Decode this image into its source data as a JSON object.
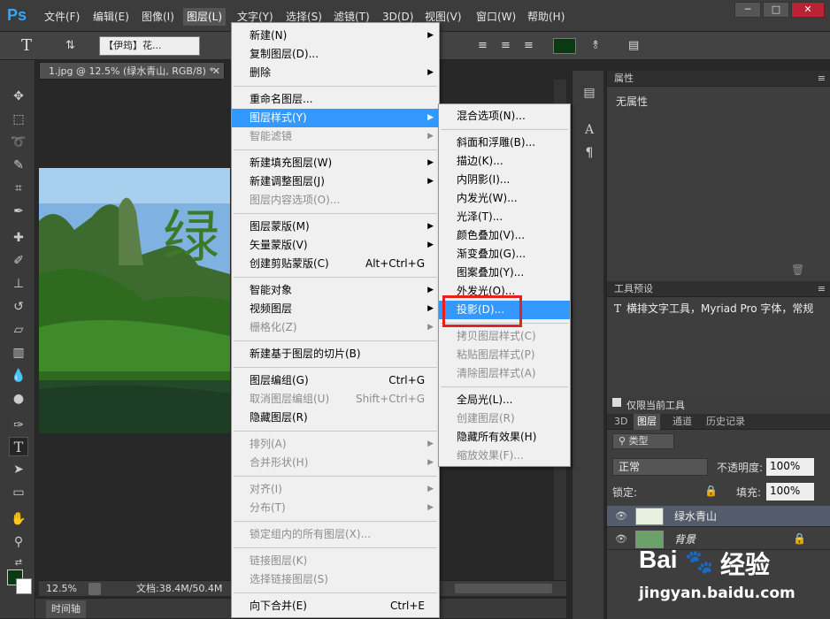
{
  "app": {
    "logo": "Ps"
  },
  "menubar": {
    "items": [
      "文件(F)",
      "编辑(E)",
      "图像(I)",
      "图层(L)",
      "文字(Y)",
      "选择(S)",
      "滤镜(T)",
      "3D(D)",
      "视图(V)",
      "窗口(W)",
      "帮助(H)"
    ],
    "window_buttons": [
      "─",
      "□",
      "✕"
    ]
  },
  "options_bar": {
    "text_tool_glyph": "T",
    "font_family": "【伊筠】花...",
    "color": "#0b3a12"
  },
  "document": {
    "tab_title": "1.jpg @ 12.5% (绿水青山, RGB/8) *",
    "canvas_text": "绿",
    "zoom": "12.5%",
    "doc_info": "文档:38.4M/50.4M"
  },
  "timeline": {
    "label": "时间轴"
  },
  "properties_panel": {
    "title": "属性",
    "content": "无属性"
  },
  "tool_presets_panel": {
    "title": "工具预设",
    "item": "横排文字工具，Myriad Pro 字体，常规",
    "checkbox_label": "仅限当前工具"
  },
  "layers_panel": {
    "tabs": [
      "3D",
      "图层",
      "通道",
      "历史记录"
    ],
    "filter_label": "类型",
    "blend_mode": "正常",
    "opacity_label": "不透明度:",
    "opacity_value": "100%",
    "lock_label": "锁定:",
    "fill_label": "填充:",
    "fill_value": "100%",
    "layers": [
      {
        "name": "绿水青山",
        "selected": true
      },
      {
        "name": "背景",
        "selected": false,
        "locked": true
      }
    ]
  },
  "layer_menu": {
    "items": [
      {
        "label": "新建(N)",
        "submenu": true
      },
      {
        "label": "复制图层(D)..."
      },
      {
        "label": "删除",
        "submenu": true
      },
      {
        "sep": true
      },
      {
        "label": "重命名图层..."
      },
      {
        "label": "图层样式(Y)",
        "submenu": true,
        "highlight": true
      },
      {
        "label": "智能滤镜",
        "submenu": true,
        "disabled": true
      },
      {
        "sep": true
      },
      {
        "label": "新建填充图层(W)",
        "submenu": true
      },
      {
        "label": "新建调整图层(J)",
        "submenu": true
      },
      {
        "label": "图层内容选项(O)...",
        "disabled": true
      },
      {
        "sep": true
      },
      {
        "label": "图层蒙版(M)",
        "submenu": true
      },
      {
        "label": "矢量蒙版(V)",
        "submenu": true
      },
      {
        "label": "创建剪贴蒙版(C)",
        "shortcut": "Alt+Ctrl+G"
      },
      {
        "sep": true
      },
      {
        "label": "智能对象",
        "submenu": true
      },
      {
        "label": "视频图层",
        "submenu": true
      },
      {
        "label": "栅格化(Z)",
        "submenu": true,
        "disabled": true
      },
      {
        "sep": true
      },
      {
        "label": "新建基于图层的切片(B)"
      },
      {
        "sep": true
      },
      {
        "label": "图层编组(G)",
        "shortcut": "Ctrl+G"
      },
      {
        "label": "取消图层编组(U)",
        "shortcut": "Shift+Ctrl+G",
        "disabled": true
      },
      {
        "label": "隐藏图层(R)"
      },
      {
        "sep": true
      },
      {
        "label": "排列(A)",
        "submenu": true,
        "disabled": true
      },
      {
        "label": "合并形状(H)",
        "submenu": true,
        "disabled": true
      },
      {
        "sep": true
      },
      {
        "label": "对齐(I)",
        "submenu": true,
        "disabled": true
      },
      {
        "label": "分布(T)",
        "submenu": true,
        "disabled": true
      },
      {
        "sep": true
      },
      {
        "label": "锁定组内的所有图层(X)...",
        "disabled": true
      },
      {
        "sep": true
      },
      {
        "label": "链接图层(K)",
        "disabled": true
      },
      {
        "label": "选择链接图层(S)",
        "disabled": true
      },
      {
        "sep": true
      },
      {
        "label": "向下合并(E)",
        "shortcut": "Ctrl+E"
      }
    ]
  },
  "layer_style_menu": {
    "items": [
      {
        "label": "混合选项(N)..."
      },
      {
        "sep": true
      },
      {
        "label": "斜面和浮雕(B)..."
      },
      {
        "label": "描边(K)..."
      },
      {
        "label": "内阴影(I)..."
      },
      {
        "label": "内发光(W)..."
      },
      {
        "label": "光泽(T)..."
      },
      {
        "label": "颜色叠加(V)..."
      },
      {
        "label": "渐变叠加(G)..."
      },
      {
        "label": "图案叠加(Y)..."
      },
      {
        "label": "外发光(O)..."
      },
      {
        "label": "投影(D)...",
        "highlight": true
      },
      {
        "sep": true
      },
      {
        "label": "拷贝图层样式(C)",
        "disabled": true
      },
      {
        "label": "粘贴图层样式(P)",
        "disabled": true
      },
      {
        "label": "清除图层样式(A)",
        "disabled": true
      },
      {
        "sep": true
      },
      {
        "label": "全局光(L)..."
      },
      {
        "label": "创建图层(R)",
        "disabled": true
      },
      {
        "label": "隐藏所有效果(H)"
      },
      {
        "label": "缩放效果(F)...",
        "disabled": true
      }
    ]
  },
  "watermark": {
    "brand": "Bai",
    "brand2": "经验",
    "url": "jingyan.baidu.com"
  }
}
